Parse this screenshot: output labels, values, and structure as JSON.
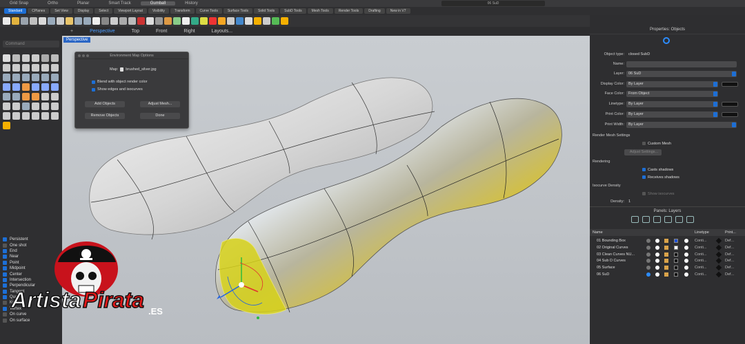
{
  "menubar": {
    "items": [
      "Grid Snap",
      "Ortho",
      "Planar",
      "Smart Track",
      "Gumball",
      "History"
    ],
    "selected_index": 4,
    "command_display": "06 SuD"
  },
  "tabs": [
    "Standard",
    "CPlanes",
    "Set View",
    "Display",
    "Select",
    "Viewport Layout",
    "Visibility",
    "Transform",
    "Curve Tools",
    "Surface Tools",
    "Solid Tools",
    "SubD Tools",
    "Mesh Tools",
    "Render Tools",
    "Drafting",
    "New in V7"
  ],
  "active_tab": 0,
  "viewport_tabs": [
    "Perspective",
    "Top",
    "Front",
    "Right",
    "Layouts..."
  ],
  "active_viewport_tab": 0,
  "viewport_label": "Perspective",
  "left_panel": {
    "command_placeholder": "Command",
    "osnaps": [
      {
        "label": "Persistent",
        "on": true
      },
      {
        "label": "One shot",
        "on": false
      },
      {
        "label": "End",
        "on": true
      },
      {
        "label": "Near",
        "on": true
      },
      {
        "label": "Point",
        "on": true
      },
      {
        "label": "Midpoint",
        "on": true
      },
      {
        "label": "Center",
        "on": true
      },
      {
        "label": "Intersection",
        "on": true
      },
      {
        "label": "Perpendicular",
        "on": true
      },
      {
        "label": "Tangent",
        "on": true
      },
      {
        "label": "Quad",
        "on": true
      },
      {
        "label": "Knot",
        "on": false
      },
      {
        "label": "Vertex",
        "on": true
      },
      {
        "label": "On curve",
        "on": false
      },
      {
        "label": "On surface",
        "on": false
      }
    ]
  },
  "env_dialog": {
    "title": "Environment Map Options",
    "map_label": "Map:",
    "map_value": "brushed_silver.jpg",
    "blend_label": "Blend with object render color",
    "show_edges_label": "Show edges and isocurves",
    "add_objects": "Add Objects",
    "adjust_mesh": "Adjust Mesh...",
    "remove_objects": "Remove Objects",
    "done": "Done"
  },
  "properties": {
    "header": "Properties: Objects",
    "object_type_label": "Object type:",
    "object_type_value": "closed SubD",
    "name_label": "Name:",
    "name_value": "",
    "layer_label": "Layer:",
    "layer_value": "06 SuD",
    "display_color_label": "Display Color:",
    "display_color_value": "By Layer",
    "face_color_label": "Face Color:",
    "face_color_value": "From Object",
    "linetype_label": "Linetype:",
    "linetype_value": "By Layer",
    "print_color_label": "Print Color:",
    "print_color_value": "By Layer",
    "print_width_label": "Print Width:",
    "print_width_value": "By Layer",
    "render_mesh_header": "Render Mesh Settings",
    "custom_mesh_label": "Custom Mesh",
    "adjust_settings_label": "Adjust Settings...",
    "rendering_header": "Rendering",
    "casts_shadows_label": "Casts shadows",
    "receives_shadows_label": "Receives shadows",
    "isocurve_header": "Isocurve Density",
    "show_isocurves_label": "Show isocurves",
    "density_label": "Density:",
    "density_value": "1"
  },
  "layers": {
    "header": "Panels: Layers",
    "col_name": "Name",
    "col_linetype": "Linetype",
    "col_print": "Print...",
    "rows": [
      {
        "name": "01 Bounding Box",
        "linetype": "Conti...",
        "print": "Def...",
        "color": "#1d4fd6"
      },
      {
        "name": "02 Original Curves",
        "linetype": "Conti...",
        "print": "Def...",
        "color": "#ffffff"
      },
      {
        "name": "03 Clean Curves NU...",
        "linetype": "Conti...",
        "print": "Def...",
        "color": "#111111"
      },
      {
        "name": "04 Sub D Curves",
        "linetype": "Conti...",
        "print": "Def...",
        "color": "#111111"
      },
      {
        "name": "05 Surface",
        "linetype": "Conti...",
        "print": "Def...",
        "color": "#111111"
      },
      {
        "name": "06 SuD",
        "linetype": "Conti...",
        "print": "Def...",
        "color": "#111111"
      }
    ]
  },
  "watermark": {
    "text_artista": "Artista",
    "text_pirata": "Pirata",
    "text_es": ".ES"
  }
}
